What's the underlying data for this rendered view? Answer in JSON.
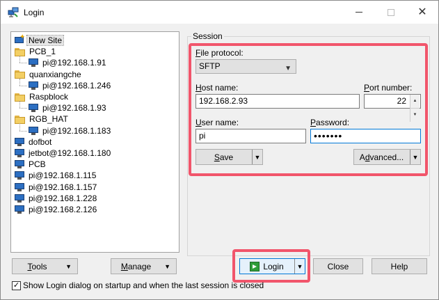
{
  "window": {
    "title": "Login",
    "minimize_label": "",
    "close_glyph": "✕"
  },
  "tree": {
    "items": [
      {
        "label": "New Site",
        "icon": "new-site-icon",
        "level": 0,
        "selected": true
      },
      {
        "label": "PCB_1",
        "icon": "folder-icon",
        "level": 0
      },
      {
        "label": "pi@192.168.1.91",
        "icon": "monitor-icon",
        "level": 1
      },
      {
        "label": "quanxiangche",
        "icon": "folder-icon",
        "level": 0
      },
      {
        "label": "pi@192.168.1.246",
        "icon": "monitor-icon",
        "level": 1
      },
      {
        "label": "Raspblock",
        "icon": "folder-icon",
        "level": 0
      },
      {
        "label": "pi@192.168.1.93",
        "icon": "monitor-icon",
        "level": 1
      },
      {
        "label": "RGB_HAT",
        "icon": "folder-icon",
        "level": 0
      },
      {
        "label": "pi@192.168.1.183",
        "icon": "monitor-icon",
        "level": 1
      },
      {
        "label": "dofbot",
        "icon": "monitor-icon",
        "level": 0
      },
      {
        "label": "jetbot@192.168.1.180",
        "icon": "monitor-icon",
        "level": 0
      },
      {
        "label": "PCB",
        "icon": "monitor-icon",
        "level": 0
      },
      {
        "label": "pi@192.168.1.115",
        "icon": "monitor-icon",
        "level": 0
      },
      {
        "label": "pi@192.168.1.157",
        "icon": "monitor-icon",
        "level": 0
      },
      {
        "label": "pi@192.168.1.228",
        "icon": "monitor-icon",
        "level": 0
      },
      {
        "label": "pi@192.168.2.126",
        "icon": "monitor-icon",
        "level": 0
      }
    ]
  },
  "session": {
    "group_label": "Session",
    "file_protocol_label_u": "F",
    "file_protocol_label_rest": "ile protocol:",
    "file_protocol_value": "SFTP",
    "host_label_u": "H",
    "host_label_rest": "ost name:",
    "host_value": "192.168.2.93",
    "port_label_u": "P",
    "port_label_rest": "ort number:",
    "port_value": "22",
    "user_label_u": "U",
    "user_label_rest": "ser name:",
    "user_value": "pi",
    "password_label_u": "P",
    "password_label_rest": "assword:",
    "password_value": "•••••••",
    "save_label_u": "S",
    "save_label_rest": "ave",
    "advanced_label_u": "d",
    "advanced_label_pre": "A",
    "advanced_label_rest": "vanced..."
  },
  "footer": {
    "tools_label_u": "T",
    "tools_label_rest": "ools",
    "manage_label_u": "M",
    "manage_label_rest": "anage",
    "login_label": "Login",
    "close_label": "Close",
    "help_label": "Help",
    "show_login_label": "Show Login dialog on startup and when the last session is closed",
    "show_login_checked": true
  },
  "colors": {
    "highlight": "#f1556b",
    "focus": "#0078d7"
  }
}
